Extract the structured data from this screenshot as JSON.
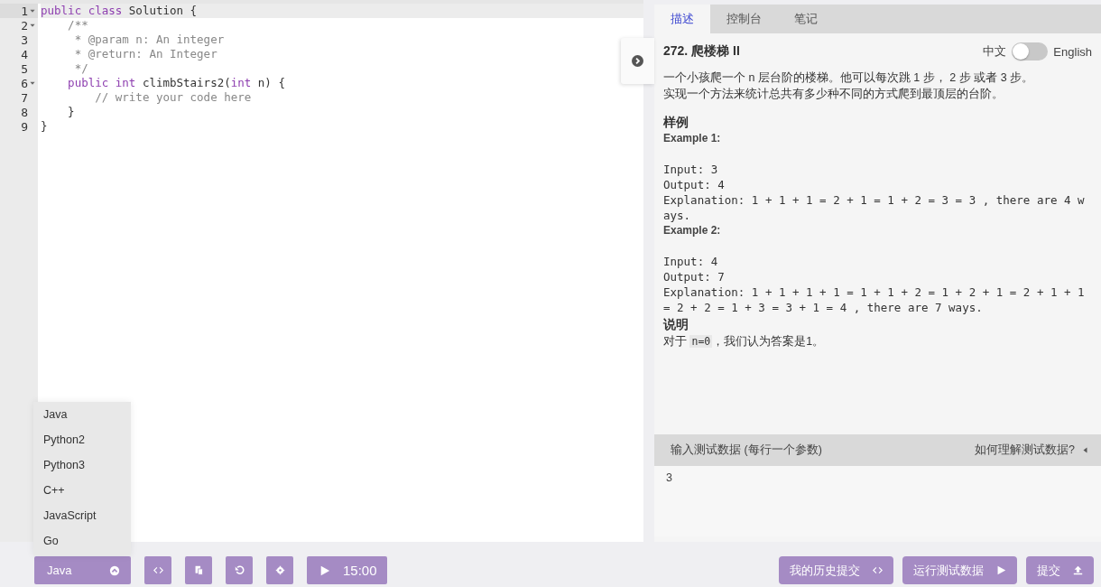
{
  "editor": {
    "lines": [
      {
        "number": "1",
        "fold": true,
        "active": true,
        "tokens": [
          {
            "kind": "keyword",
            "text": "public class"
          },
          {
            "kind": "plain",
            "text": " Solution {"
          }
        ]
      },
      {
        "number": "2",
        "fold": true,
        "active": false,
        "tokens": [
          {
            "kind": "comment",
            "text": "    /**"
          }
        ]
      },
      {
        "number": "3",
        "fold": false,
        "active": false,
        "tokens": [
          {
            "kind": "comment",
            "text": "     * @param n: An integer"
          }
        ]
      },
      {
        "number": "4",
        "fold": false,
        "active": false,
        "tokens": [
          {
            "kind": "comment",
            "text": "     * @return: An Integer"
          }
        ]
      },
      {
        "number": "5",
        "fold": false,
        "active": false,
        "tokens": [
          {
            "kind": "comment",
            "text": "     */"
          }
        ]
      },
      {
        "number": "6",
        "fold": true,
        "active": false,
        "tokens": [
          {
            "kind": "keyword",
            "text": "    public int"
          },
          {
            "kind": "plain",
            "text": " climbStairs2("
          },
          {
            "kind": "keyword",
            "text": "int"
          },
          {
            "kind": "plain",
            "text": " n) {"
          }
        ]
      },
      {
        "number": "7",
        "fold": false,
        "active": false,
        "tokens": [
          {
            "kind": "comment",
            "text": "        // write your code here"
          }
        ]
      },
      {
        "number": "8",
        "fold": false,
        "active": false,
        "tokens": [
          {
            "kind": "plain",
            "text": "    }"
          }
        ]
      },
      {
        "number": "9",
        "fold": false,
        "active": false,
        "tokens": [
          {
            "kind": "plain",
            "text": "}"
          }
        ]
      }
    ]
  },
  "language_menu": {
    "options": [
      "Java",
      "Python2",
      "Python3",
      "C++",
      "JavaScript",
      "Go"
    ]
  },
  "toolbar": {
    "language": "Java",
    "timer": "15:00"
  },
  "tabs": [
    {
      "label": "描述",
      "selected": true
    },
    {
      "label": "控制台",
      "selected": false
    },
    {
      "label": "笔记",
      "selected": false
    }
  ],
  "problem": {
    "title": "272. 爬楼梯 II",
    "language_toggle": {
      "left_label": "中文",
      "right_label": "English",
      "on": false
    },
    "blocks": [
      {
        "kind": "paragraph",
        "text": "一个小孩爬一个 n 层台阶的楼梯。他可以每次跳 1 步， 2 步 或者 3 步。"
      },
      {
        "kind": "paragraph",
        "text": "实现一个方法来统计总共有多少种不同的方式爬到最顶层的台阶。"
      },
      {
        "kind": "heading",
        "text": "样例"
      },
      {
        "kind": "label",
        "text": "Example 1:"
      },
      {
        "kind": "code",
        "text": "\nInput: 3\nOutput: 4\nExplanation: 1 + 1 + 1 = 2 + 1 = 1 + 2 = 3 = 3 , there are 4 ways."
      },
      {
        "kind": "label",
        "text": "Example 2:"
      },
      {
        "kind": "code",
        "text": "\nInput: 4\nOutput: 7\nExplanation: 1 + 1 + 1 + 1 = 1 + 1 + 2 = 1 + 2 + 1 = 2 + 1 + 1 = 2 + 2 = 1 + 3 = 3 + 1 = 4 , there are 7 ways."
      },
      {
        "kind": "heading",
        "text": "说明"
      },
      {
        "kind": "note",
        "parts": [
          {
            "kind": "text",
            "text": "对于 "
          },
          {
            "kind": "code",
            "text": "n=0"
          },
          {
            "kind": "text",
            "text": "，我们认为答案是1。"
          }
        ]
      }
    ]
  },
  "test_data": {
    "label": "输入测试数据 (每行一个参数)",
    "help_link": "如何理解测试数据?",
    "value": "3"
  },
  "actions": [
    {
      "kind": "history",
      "label": "我的历史提交"
    },
    {
      "kind": "run",
      "label": "运行测试数据"
    },
    {
      "kind": "submit",
      "label": "提交"
    }
  ]
}
